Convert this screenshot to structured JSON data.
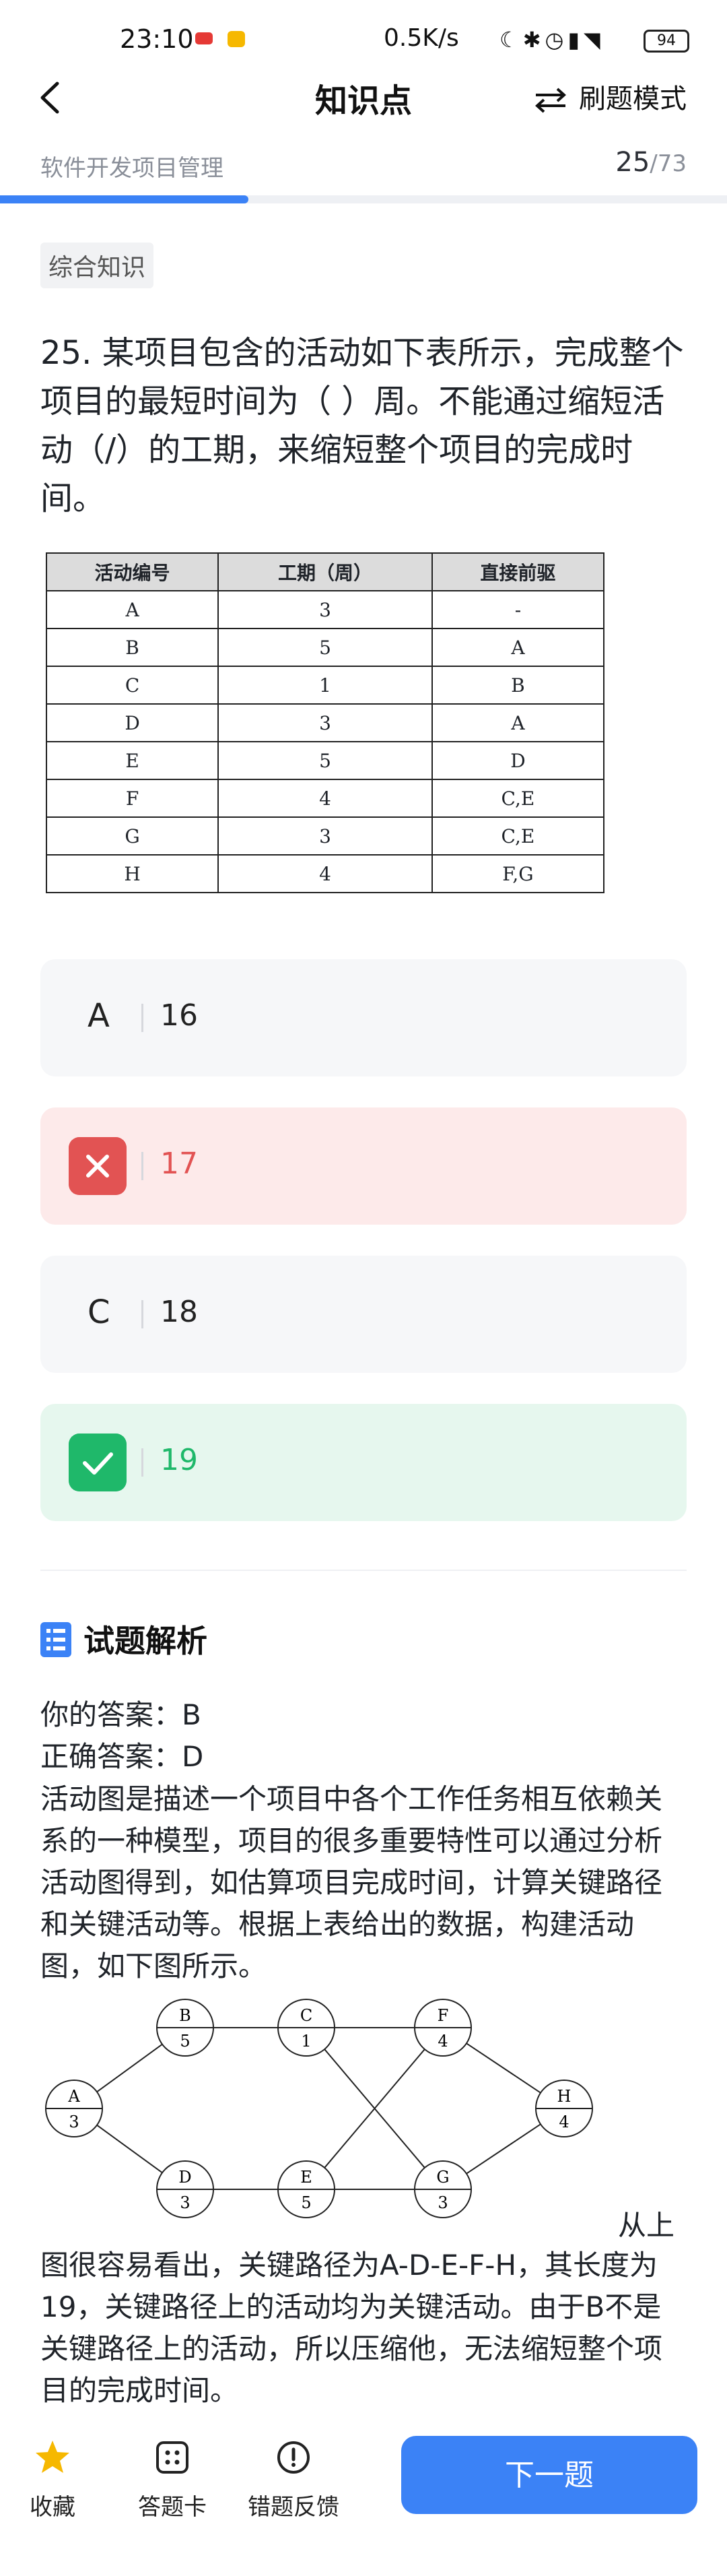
{
  "status_bar": {
    "time": "23:10",
    "network_speed": "0.5K/s",
    "battery": "94"
  },
  "nav": {
    "title": "知识点",
    "mode_label": "刷题模式"
  },
  "header": {
    "subject": "软件开发项目管理",
    "current": "25",
    "total": "/73",
    "progress_fraction": 0.342
  },
  "tag": "综合知识",
  "question": {
    "text": "25. 某项目包含的活动如下表所示，完成整个项目的最短时间为（ ）周。不能通过缩短活动（/）的工期，来缩短整个项目的完成时间。",
    "table": {
      "headers": [
        "活动编号",
        "工期（周）",
        "直接前驱"
      ],
      "rows": [
        [
          "A",
          "3",
          "-"
        ],
        [
          "B",
          "5",
          "A"
        ],
        [
          "C",
          "1",
          "B"
        ],
        [
          "D",
          "3",
          "A"
        ],
        [
          "E",
          "5",
          "D"
        ],
        [
          "F",
          "4",
          "C,E"
        ],
        [
          "G",
          "3",
          "C,E"
        ],
        [
          "H",
          "4",
          "F,G"
        ]
      ]
    }
  },
  "options": [
    {
      "letter": "A",
      "text": "16",
      "state": "normal"
    },
    {
      "letter": "B",
      "text": "17",
      "state": "wrong"
    },
    {
      "letter": "C",
      "text": "18",
      "state": "normal"
    },
    {
      "letter": "D",
      "text": "19",
      "state": "correct"
    }
  ],
  "analysis": {
    "title": "试题解析",
    "your_answer": "你的答案：B",
    "correct_answer": "正确答案：D",
    "body": "活动图是描述一个项目中各个工作任务相互依赖关系的一种模型，项目的很多重要特性可以通过分析活动图得到，如估算项目完成时间，计算关键路径和关键活动等。根据上表给出的数据，构建活动图，如下图所示。",
    "tail_inline": "从上",
    "tail": "图很容易看出，关键路径为A-D-E-F-H，其长度为19，关键路径上的活动均为关键活动。由于B不是关键路径上的活动，所以压缩他，无法缩短整个项目的完成时间。",
    "diagram_nodes": [
      {
        "name": "A",
        "dur": "3"
      },
      {
        "name": "B",
        "dur": "5"
      },
      {
        "name": "C",
        "dur": "1"
      },
      {
        "name": "D",
        "dur": "3"
      },
      {
        "name": "E",
        "dur": "5"
      },
      {
        "name": "F",
        "dur": "4"
      },
      {
        "name": "G",
        "dur": "3"
      },
      {
        "name": "H",
        "dur": "4"
      }
    ]
  },
  "bottom_bar": {
    "favorite": "收藏",
    "answer_card": "答题卡",
    "feedback": "错题反馈",
    "next": "下一题"
  },
  "colors": {
    "accent": "#3b82f6",
    "wrong": "#e25353",
    "correct": "#1fb86a",
    "star": "#f6b800"
  }
}
